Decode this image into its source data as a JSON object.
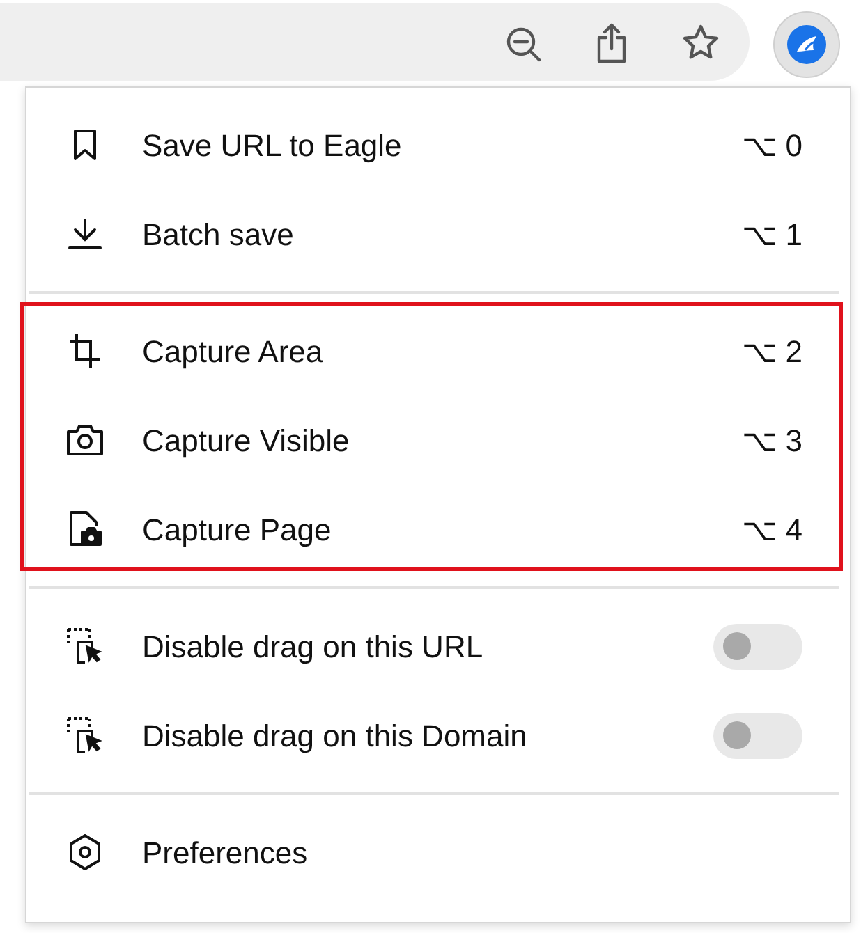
{
  "sections": [
    {
      "highlighted": false,
      "items": [
        {
          "kind": "shortcut",
          "label": "Save URL to Eagle",
          "shortcut": "⌥ 0"
        },
        {
          "kind": "shortcut",
          "label": "Batch save",
          "shortcut": "⌥ 1"
        }
      ]
    },
    {
      "highlighted": true,
      "items": [
        {
          "kind": "shortcut",
          "label": "Capture Area",
          "shortcut": "⌥ 2"
        },
        {
          "kind": "shortcut",
          "label": "Capture Visible",
          "shortcut": "⌥ 3"
        },
        {
          "kind": "shortcut",
          "label": "Capture Page",
          "shortcut": "⌥ 4"
        }
      ]
    },
    {
      "highlighted": false,
      "items": [
        {
          "kind": "toggle",
          "label": "Disable drag on this URL",
          "on": false
        },
        {
          "kind": "toggle",
          "label": "Disable drag on this Domain",
          "on": false
        }
      ]
    },
    {
      "highlighted": false,
      "items": [
        {
          "kind": "plain",
          "label": "Preferences"
        }
      ]
    }
  ]
}
